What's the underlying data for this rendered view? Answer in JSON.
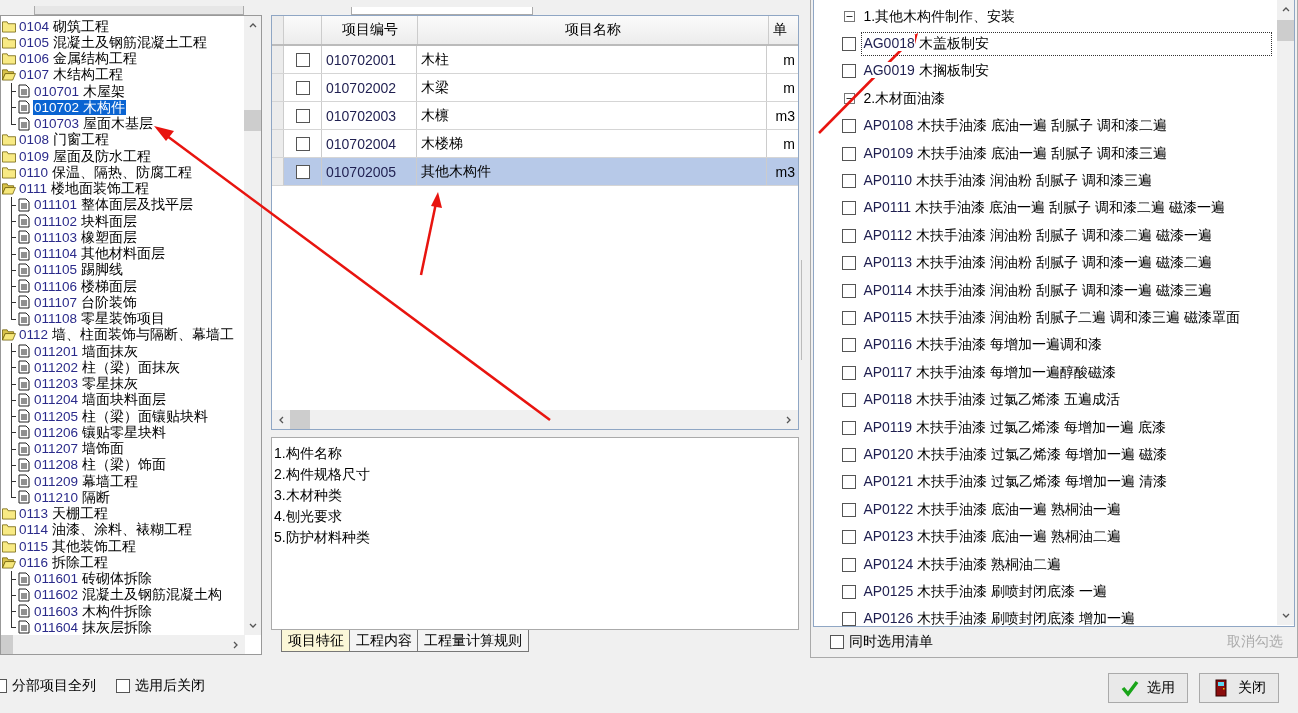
{
  "tree": [
    {
      "code": "0104",
      "name": "砌筑工程",
      "expanded": false,
      "selected": false
    },
    {
      "code": "0105",
      "name": "混凝土及钢筋混凝土工程",
      "expanded": false,
      "selected": false
    },
    {
      "code": "0106",
      "name": "金属结构工程",
      "expanded": false,
      "selected": false
    },
    {
      "code": "0107",
      "name": "木结构工程",
      "expanded": true,
      "selected": false,
      "children": [
        {
          "code": "010701",
          "name": "木屋架",
          "selected": false
        },
        {
          "code": "010702",
          "name": "木构件",
          "selected": true
        },
        {
          "code": "010703",
          "name": "屋面木基层",
          "selected": false
        }
      ]
    },
    {
      "code": "0108",
      "name": "门窗工程",
      "expanded": false,
      "selected": false
    },
    {
      "code": "0109",
      "name": "屋面及防水工程",
      "expanded": false,
      "selected": false
    },
    {
      "code": "0110",
      "name": "保温、隔热、防腐工程",
      "expanded": false,
      "selected": false
    },
    {
      "code": "0111",
      "name": "楼地面装饰工程",
      "expanded": true,
      "selected": false,
      "children": [
        {
          "code": "011101",
          "name": "整体面层及找平层",
          "selected": false
        },
        {
          "code": "011102",
          "name": "块料面层",
          "selected": false
        },
        {
          "code": "011103",
          "name": "橡塑面层",
          "selected": false
        },
        {
          "code": "011104",
          "name": "其他材料面层",
          "selected": false
        },
        {
          "code": "011105",
          "name": "踢脚线",
          "selected": false
        },
        {
          "code": "011106",
          "name": "楼梯面层",
          "selected": false
        },
        {
          "code": "011107",
          "name": "台阶装饰",
          "selected": false
        },
        {
          "code": "011108",
          "name": "零星装饰项目",
          "selected": false
        }
      ]
    },
    {
      "code": "0112",
      "name": "墙、柱面装饰与隔断、幕墙工",
      "expanded": true,
      "selected": false,
      "children": [
        {
          "code": "011201",
          "name": "墙面抹灰",
          "selected": false
        },
        {
          "code": "011202",
          "name": "柱（梁）面抹灰",
          "selected": false
        },
        {
          "code": "011203",
          "name": "零星抹灰",
          "selected": false
        },
        {
          "code": "011204",
          "name": "墙面块料面层",
          "selected": false
        },
        {
          "code": "011205",
          "name": "柱（梁）面镶贴块料",
          "selected": false
        },
        {
          "code": "011206",
          "name": "镶贴零星块料",
          "selected": false
        },
        {
          "code": "011207",
          "name": "墙饰面",
          "selected": false
        },
        {
          "code": "011208",
          "name": "柱（梁）饰面",
          "selected": false
        },
        {
          "code": "011209",
          "name": "幕墙工程",
          "selected": false
        },
        {
          "code": "011210",
          "name": "隔断",
          "selected": false
        }
      ]
    },
    {
      "code": "0113",
      "name": "天棚工程",
      "expanded": false,
      "selected": false
    },
    {
      "code": "0114",
      "name": "油漆、涂料、裱糊工程",
      "expanded": false,
      "selected": false
    },
    {
      "code": "0115",
      "name": "其他装饰工程",
      "expanded": false,
      "selected": false
    },
    {
      "code": "0116",
      "name": "拆除工程",
      "expanded": true,
      "selected": false,
      "children": [
        {
          "code": "011601",
          "name": "砖砌体拆除",
          "selected": false
        },
        {
          "code": "011602",
          "name": "混凝土及钢筋混凝土构",
          "selected": false
        },
        {
          "code": "011603",
          "name": "木构件拆除",
          "selected": false
        },
        {
          "code": "011604",
          "name": "抹灰层拆除",
          "selected": false
        }
      ]
    }
  ],
  "table": {
    "columns": [
      "项目编号",
      "项目名称",
      "单"
    ],
    "rows": [
      {
        "checked": false,
        "selected": false,
        "code": "010702001",
        "name": "木柱",
        "unit": "m"
      },
      {
        "checked": false,
        "selected": false,
        "code": "010702002",
        "name": "木梁",
        "unit": "m"
      },
      {
        "checked": false,
        "selected": false,
        "code": "010702003",
        "name": "木檩",
        "unit": "m3"
      },
      {
        "checked": false,
        "selected": false,
        "code": "010702004",
        "name": "木楼梯",
        "unit": "m"
      },
      {
        "checked": false,
        "selected": true,
        "code": "010702005",
        "name": "其他木构件",
        "unit": "m3"
      }
    ]
  },
  "features": [
    "1.构件名称",
    "2.构件规格尺寸",
    "3.木材种类",
    "4.刨光要求",
    "5.防护材料种类"
  ],
  "tabs": [
    {
      "label": "项目特征",
      "selected": true
    },
    {
      "label": "工程内容",
      "selected": false
    },
    {
      "label": "工程量计算规则",
      "selected": false
    }
  ],
  "options": [
    {
      "label": "分部项目全列",
      "checked": false
    },
    {
      "label": "选用后关闭",
      "checked": false
    }
  ],
  "quota_list": [
    {
      "kind": "group",
      "label": "1.其他木构件制作、安装",
      "expanded": true
    },
    {
      "kind": "item",
      "code": "AG0018",
      "name": "木盖板制安",
      "checked": false,
      "focused": true
    },
    {
      "kind": "item",
      "code": "AG0019",
      "name": "木搁板制安",
      "checked": false,
      "focused": false
    },
    {
      "kind": "group",
      "label": "2.木材面油漆",
      "expanded": true
    },
    {
      "kind": "item",
      "code": "AP0108",
      "name": "木扶手油漆 底油一遍 刮腻子 调和漆二遍",
      "checked": false,
      "focused": false
    },
    {
      "kind": "item",
      "code": "AP0109",
      "name": "木扶手油漆 底油一遍 刮腻子 调和漆三遍",
      "checked": false,
      "focused": false
    },
    {
      "kind": "item",
      "code": "AP0110",
      "name": "木扶手油漆 润油粉 刮腻子 调和漆三遍",
      "checked": false,
      "focused": false
    },
    {
      "kind": "item",
      "code": "AP0111",
      "name": "木扶手油漆 底油一遍 刮腻子 调和漆二遍 磁漆一遍",
      "checked": false,
      "focused": false
    },
    {
      "kind": "item",
      "code": "AP0112",
      "name": "木扶手油漆 润油粉 刮腻子 调和漆二遍 磁漆一遍",
      "checked": false,
      "focused": false
    },
    {
      "kind": "item",
      "code": "AP0113",
      "name": "木扶手油漆 润油粉 刮腻子 调和漆一遍 磁漆二遍",
      "checked": false,
      "focused": false
    },
    {
      "kind": "item",
      "code": "AP0114",
      "name": "木扶手油漆 润油粉 刮腻子 调和漆一遍 磁漆三遍",
      "checked": false,
      "focused": false
    },
    {
      "kind": "item",
      "code": "AP0115",
      "name": "木扶手油漆 润油粉 刮腻子二遍 调和漆三遍 磁漆罩面",
      "checked": false,
      "focused": false
    },
    {
      "kind": "item",
      "code": "AP0116",
      "name": "木扶手油漆 每增加一遍调和漆",
      "checked": false,
      "focused": false
    },
    {
      "kind": "item",
      "code": "AP0117",
      "name": "木扶手油漆 每增加一遍醇酸磁漆",
      "checked": false,
      "focused": false
    },
    {
      "kind": "item",
      "code": "AP0118",
      "name": "木扶手油漆 过氯乙烯漆 五遍成活",
      "checked": false,
      "focused": false
    },
    {
      "kind": "item",
      "code": "AP0119",
      "name": "木扶手油漆 过氯乙烯漆 每增加一遍 底漆",
      "checked": false,
      "focused": false
    },
    {
      "kind": "item",
      "code": "AP0120",
      "name": "木扶手油漆 过氯乙烯漆 每增加一遍 磁漆",
      "checked": false,
      "focused": false
    },
    {
      "kind": "item",
      "code": "AP0121",
      "name": "木扶手油漆 过氯乙烯漆 每增加一遍 清漆",
      "checked": false,
      "focused": false
    },
    {
      "kind": "item",
      "code": "AP0122",
      "name": "木扶手油漆 底油一遍 熟桐油一遍",
      "checked": false,
      "focused": false
    },
    {
      "kind": "item",
      "code": "AP0123",
      "name": "木扶手油漆 底油一遍 熟桐油二遍",
      "checked": false,
      "focused": false
    },
    {
      "kind": "item",
      "code": "AP0124",
      "name": "木扶手油漆 熟桐油二遍",
      "checked": false,
      "focused": false
    },
    {
      "kind": "item",
      "code": "AP0125",
      "name": "木扶手油漆 刷喷封闭底漆 一遍",
      "checked": false,
      "focused": false
    },
    {
      "kind": "item",
      "code": "AP0126",
      "name": "木扶手油漆 刷喷封闭底漆 增加一遍",
      "checked": false,
      "focused": false
    }
  ],
  "also_select": {
    "label": "同时选用清单",
    "checked": false
  },
  "uncheck_link": {
    "label": "取消勾选",
    "disabled": true
  },
  "buttons": [
    {
      "kind": "ok",
      "label": "选用"
    },
    {
      "kind": "close",
      "label": "关闭"
    }
  ]
}
